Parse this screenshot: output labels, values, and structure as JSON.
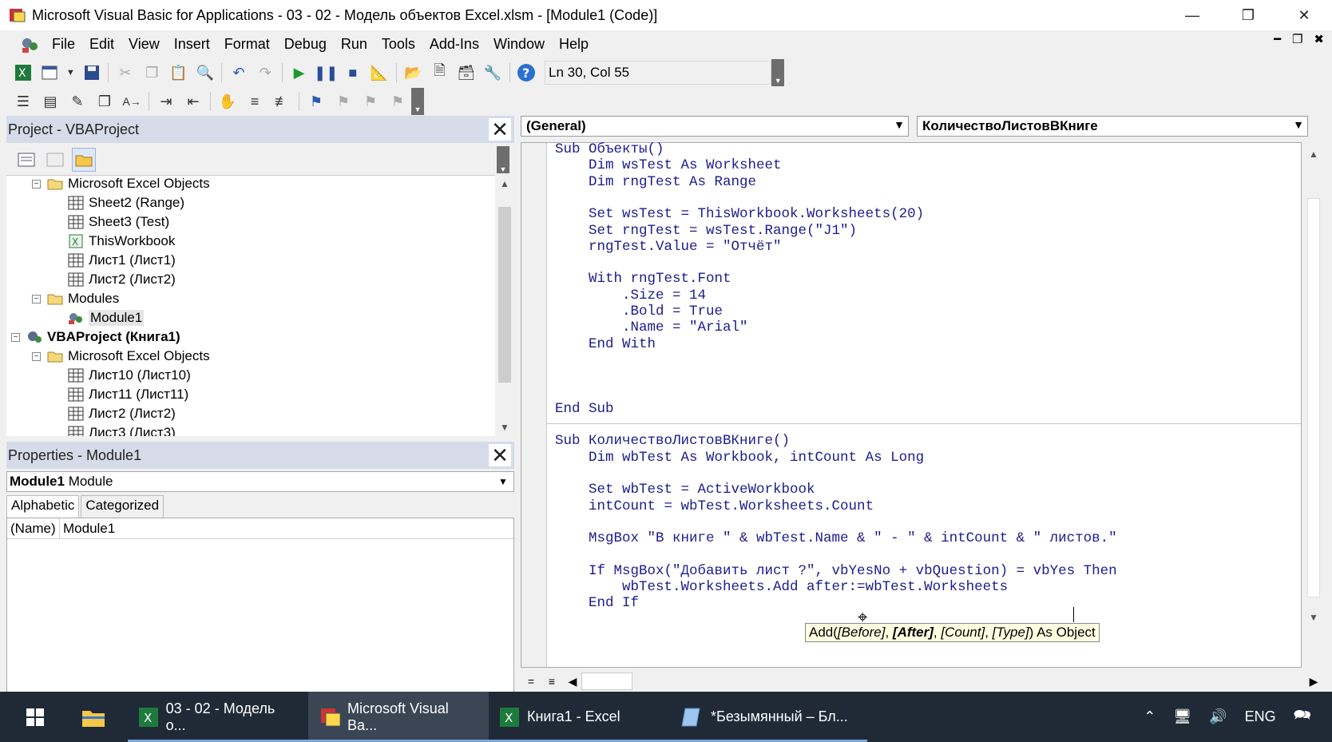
{
  "window": {
    "title": "Microsoft Visual Basic for Applications - 03 - 02 -  Модель объектов Excel.xlsm - [Module1 (Code)]",
    "controls": [
      "minimize-icon",
      "restore-icon",
      "close-icon"
    ]
  },
  "menu": {
    "items": [
      "File",
      "Edit",
      "View",
      "Insert",
      "Format",
      "Debug",
      "Run",
      "Tools",
      "Add-Ins",
      "Window",
      "Help"
    ]
  },
  "toolbar": {
    "position": "Ln 30, Col 55"
  },
  "project": {
    "title": "Project - VBAProject",
    "tree": [
      {
        "label": "Microsoft Excel Objects",
        "level": 1,
        "type": "folder",
        "expander": "−"
      },
      {
        "label": "Sheet2 (Range)",
        "level": 2,
        "type": "sheet"
      },
      {
        "label": "Sheet3 (Test)",
        "level": 2,
        "type": "sheet"
      },
      {
        "label": "ThisWorkbook",
        "level": 2,
        "type": "workbook"
      },
      {
        "label": "Лист1 (Лист1)",
        "level": 2,
        "type": "sheet"
      },
      {
        "label": "Лист2 (Лист2)",
        "level": 2,
        "type": "sheet"
      },
      {
        "label": "Modules",
        "level": 1,
        "type": "folder",
        "expander": "−"
      },
      {
        "label": "Module1",
        "level": 2,
        "type": "module",
        "selected": true
      },
      {
        "label": "VBAProject (Книга1)",
        "level": 0,
        "type": "project",
        "bold": true,
        "expander": "−"
      },
      {
        "label": "Microsoft Excel Objects",
        "level": 1,
        "type": "folder",
        "expander": "−"
      },
      {
        "label": "Лист10 (Лист10)",
        "level": 2,
        "type": "sheet"
      },
      {
        "label": "Лист11 (Лист11)",
        "level": 2,
        "type": "sheet"
      },
      {
        "label": "Лист2 (Лист2)",
        "level": 2,
        "type": "sheet"
      },
      {
        "label": "Лист3 (Лист3)",
        "level": 2,
        "type": "sheet"
      }
    ]
  },
  "properties": {
    "title": "Properties - Module1",
    "object_name": "Module1",
    "object_type": "Module",
    "tabs": [
      "Alphabetic",
      "Categorized"
    ],
    "rows": [
      {
        "name": "(Name)",
        "value": "Module1"
      }
    ]
  },
  "code": {
    "object_combo": "(General)",
    "proc_combo": "КоличествоЛистовВКниге",
    "lines": [
      "Sub Объекты()",
      "    Dim wsTest As Worksheet",
      "    Dim rngTest As Range",
      "",
      "    Set wsTest = ThisWorkbook.Worksheets(20)",
      "    Set rngTest = wsTest.Range(\"J1\")",
      "    rngTest.Value = \"Отчёт\"",
      "",
      "    With rngTest.Font",
      "        .Size = 14",
      "        .Bold = True",
      "        .Name = \"Arial\"",
      "    End With",
      "",
      "",
      "",
      "End Sub",
      "",
      "Sub КоличествоЛистовВКниге()",
      "    Dim wbTest As Workbook, intCount As Long",
      "",
      "    Set wbTest = ActiveWorkbook",
      "    intCount = wbTest.Worksheets.Count",
      "",
      "    MsgBox \"В книге \" & wbTest.Name & \" - \" & intCount & \" листов.\"",
      "",
      "    If MsgBox(\"Добавить лист ?\", vbYesNo + vbQuestion) = vbYes Then",
      "        wbTest.Worksheets.Add after:=wbTest.Worksheets",
      "    End If"
    ],
    "tooltip": {
      "prefix": "Add(",
      "before": "[Before]",
      "sep1": ", ",
      "after": "[After]",
      "sep2": ", ",
      "count": "[Count]",
      "sep3": ", ",
      "type": "[Type]",
      "suffix": ") As Object"
    }
  },
  "taskbar": {
    "items": [
      {
        "label": "03 - 02 -  Модель о...",
        "icon": "excel-icon",
        "active": false
      },
      {
        "label": "Microsoft Visual Ba...",
        "icon": "vba-icon",
        "active": true
      },
      {
        "label": "Книга1 - Excel",
        "icon": "excel-icon",
        "active": false
      },
      {
        "label": "*Безымянный – Бл...",
        "icon": "notepad-icon",
        "active": false
      }
    ],
    "language": "ENG"
  }
}
